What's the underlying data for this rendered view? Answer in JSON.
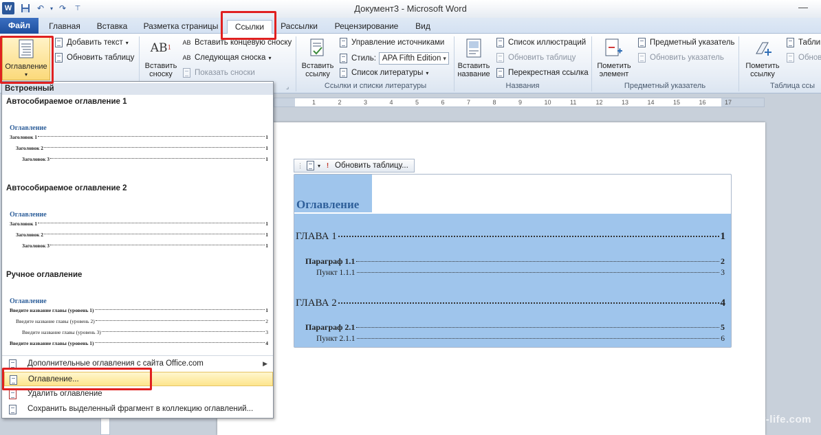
{
  "window": {
    "title": "Документ3  -  Microsoft Word"
  },
  "tabs": {
    "file": "Файл",
    "items": [
      "Главная",
      "Вставка",
      "Разметка страницы",
      "Ссылки",
      "Рассылки",
      "Рецензирование",
      "Вид"
    ]
  },
  "ribbon": {
    "toc": {
      "label": "Оглавление",
      "add_text": "Добавить текст",
      "update_table": "Обновить таблицу"
    },
    "footnotes": {
      "insert_footnote": "Вставить сноску",
      "insert_endnote": "Вставить концевую сноску",
      "next_footnote": "Следующая сноска",
      "show_notes": "Показать сноски"
    },
    "citations": {
      "insert_citation": "Вставить ссылку",
      "manage_sources": "Управление источниками",
      "style_label": "Стиль:",
      "style_value": "APA Fifth Edition",
      "bibliography": "Список литературы",
      "group_label": "Ссылки и списки литературы"
    },
    "captions": {
      "insert_caption": "Вставить название",
      "table_of_figures": "Список иллюстраций",
      "update_table": "Обновить таблицу",
      "cross_reference": "Перекрестная ссылка",
      "group_label": "Названия"
    },
    "index": {
      "mark_entry": "Пометить элемент",
      "insert_index": "Предметный указатель",
      "update_index": "Обновить указатель",
      "group_label": "Предметный указатель"
    },
    "authorities": {
      "mark_citation": "Пометить ссылку",
      "insert_table": "Таблиц",
      "update": "Обнов",
      "group_label": "Таблица ссы"
    },
    "ruler_numbers": [
      "1",
      "2",
      "3",
      "4",
      "5",
      "6",
      "7",
      "8",
      "9",
      "10",
      "11",
      "12",
      "13",
      "14",
      "15",
      "16",
      "17"
    ]
  },
  "toc_menu": {
    "section": "Встроенный",
    "auto1": {
      "title": "Автособираемое оглавление 1",
      "heading": "Оглавление",
      "lines": [
        {
          "text": "Заголовок 1",
          "page": "1"
        },
        {
          "text": "Заголовок 2",
          "page": "1"
        },
        {
          "text": "Заголовок 3",
          "page": "1"
        }
      ]
    },
    "auto2": {
      "title": "Автособираемое оглавление 2",
      "heading": "Оглавление",
      "lines": [
        {
          "text": "Заголовок 1",
          "page": "1"
        },
        {
          "text": "Заголовок 2",
          "page": "1"
        },
        {
          "text": "Заголовок 3",
          "page": "1"
        }
      ]
    },
    "manual": {
      "title": "Ручное оглавление",
      "heading": "Оглавление",
      "lines": [
        {
          "text": "Введите название главы (уровень 1)",
          "page": "1"
        },
        {
          "text": "Введите название главы (уровень 2)",
          "page": "2"
        },
        {
          "text": "Введите название главы (уровень 3)",
          "page": "3"
        },
        {
          "text": "Введите название главы (уровень 1)",
          "page": "4"
        }
      ]
    },
    "more_online": "Дополнительные оглавления с сайта Office.com",
    "custom_toc": "Оглавление...",
    "remove_toc": "Удалить оглавление",
    "save_selection": "Сохранить выделенный фрагмент в коллекцию оглавлений..."
  },
  "document": {
    "toc_toolbar_update": "Обновить таблицу...",
    "toc_heading": "Оглавление",
    "entries": [
      {
        "text": "ГЛАВА 1",
        "page": "1",
        "level": 1
      },
      {
        "text": "Параграф 1.1",
        "page": "2",
        "level": 2
      },
      {
        "text": "Пункт 1.1.1",
        "page": "3",
        "level": 3
      },
      {
        "text": "ГЛАВА 2",
        "page": "4",
        "level": 1
      },
      {
        "text": "Параграф 2.1",
        "page": "5",
        "level": 2
      },
      {
        "text": "Пункт 2.1.1",
        "page": "6",
        "level": 3
      }
    ]
  },
  "watermark": "user-life.com",
  "colors": {
    "highlight_red": "#e02020",
    "selection_blue": "#9fc5ec",
    "heading_blue": "#2e5f9a",
    "file_tab": "#2b579a"
  }
}
